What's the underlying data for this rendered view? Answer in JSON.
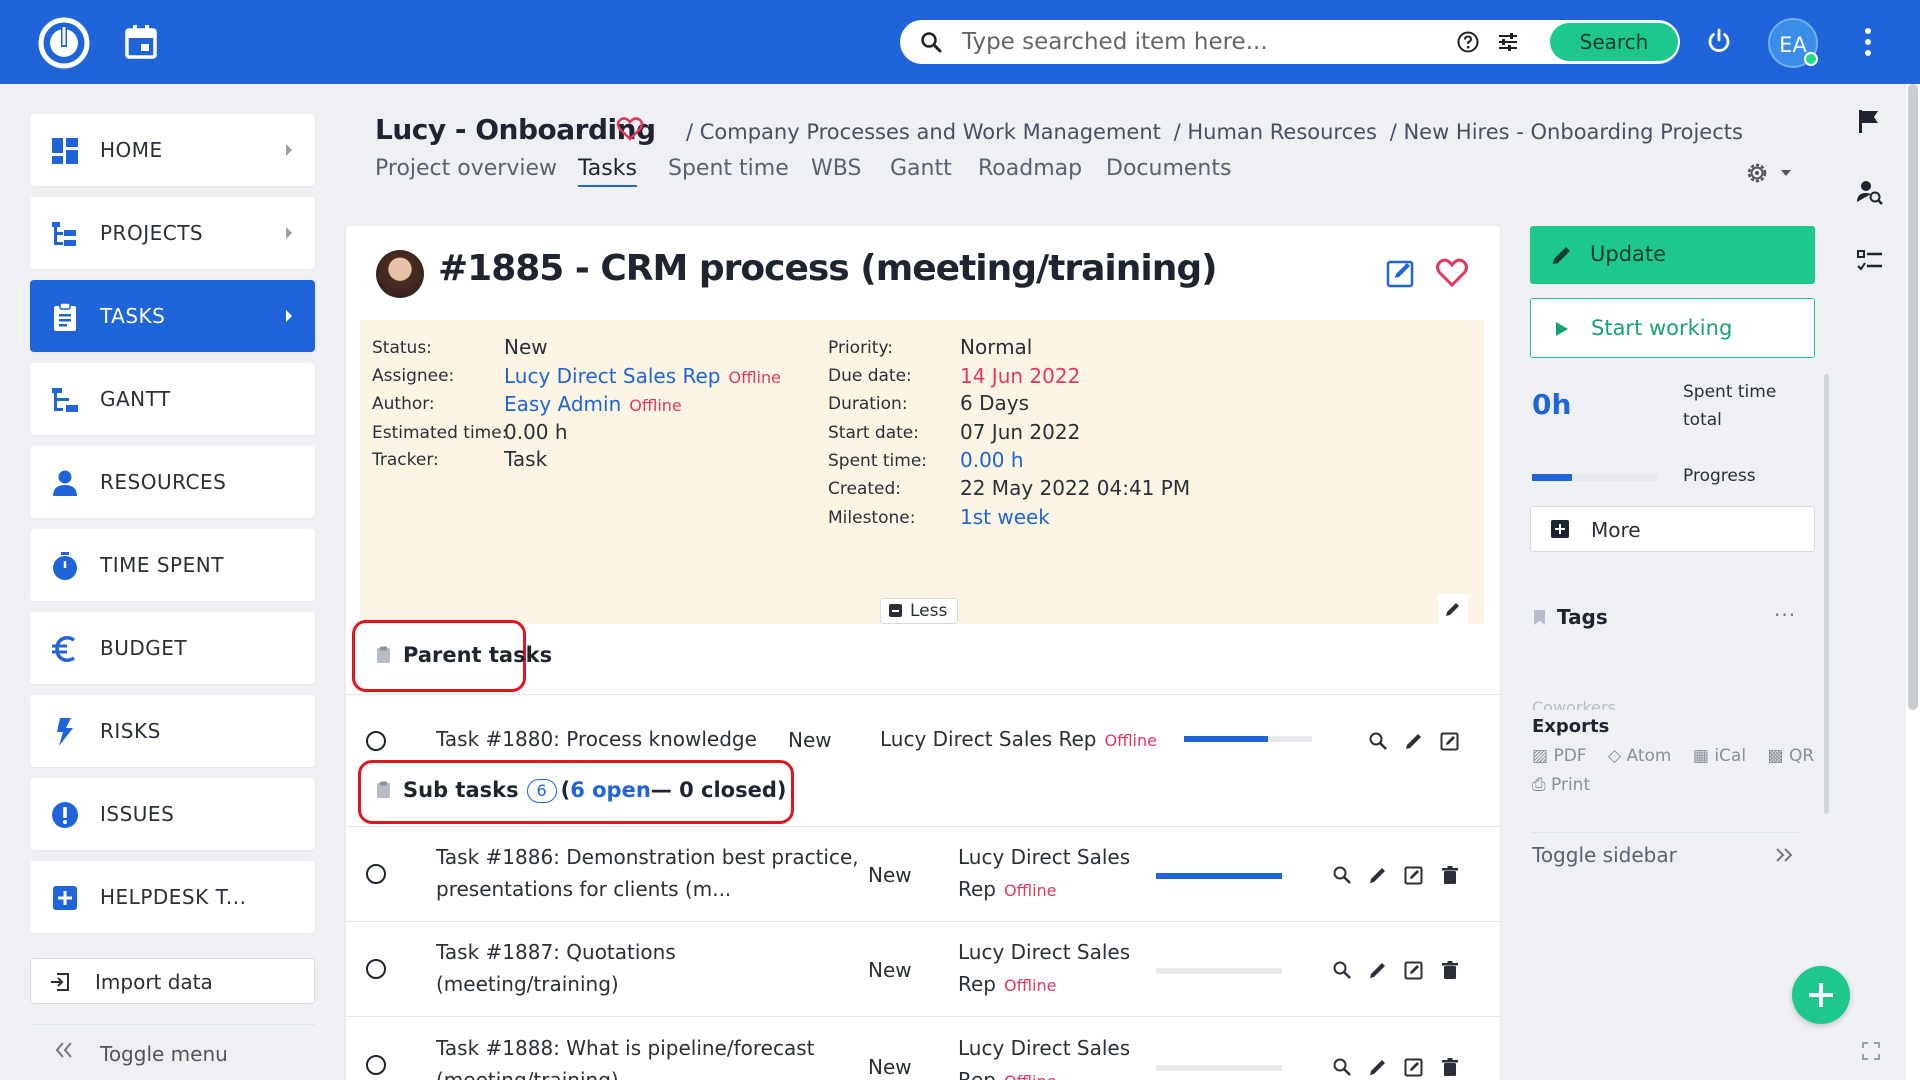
{
  "topbar": {
    "search_placeholder": "Type searched item here...",
    "search_button": "Search",
    "avatar_initials": "EA",
    "colors": {
      "bar": "#1f64d8",
      "accent": "#1ec78c"
    }
  },
  "leftmenu": {
    "items": [
      {
        "label": "HOME",
        "icon": "dashboard-icon",
        "active": false,
        "chevron": true
      },
      {
        "label": "PROJECTS",
        "icon": "projects-tree-icon",
        "active": false,
        "chevron": true
      },
      {
        "label": "TASKS",
        "icon": "clipboard-icon",
        "active": true,
        "chevron": true
      },
      {
        "label": "GANTT",
        "icon": "gantt-icon",
        "active": false,
        "chevron": false
      },
      {
        "label": "RESOURCES",
        "icon": "person-icon",
        "active": false,
        "chevron": false
      },
      {
        "label": "TIME SPENT",
        "icon": "stopwatch-icon",
        "active": false,
        "chevron": false
      },
      {
        "label": "BUDGET",
        "icon": "euro-icon",
        "active": false,
        "chevron": false
      },
      {
        "label": "RISKS",
        "icon": "lightning-icon",
        "active": false,
        "chevron": false
      },
      {
        "label": "ISSUES",
        "icon": "exclamation-icon",
        "active": false,
        "chevron": false
      },
      {
        "label": "HELPDESK T...",
        "icon": "plus-square-icon",
        "active": false,
        "chevron": false
      }
    ],
    "import_label": "Import data",
    "toggle_label": "Toggle menu"
  },
  "header": {
    "project_title": "Lucy - Onboarding",
    "breadcrumb": [
      "/ Company Processes and Work Management",
      "/ Human Resources",
      "/ New Hires - Onboarding Projects"
    ],
    "tabs": [
      "Project overview",
      "Tasks",
      "Spent time",
      "WBS",
      "Gantt",
      "Roadmap",
      "Documents"
    ],
    "active_tab": "Tasks"
  },
  "task": {
    "title": "#1885 - CRM process (meeting/training)",
    "left_attrs": {
      "status_label": "Status:",
      "status": "New",
      "assignee_label": "Assignee:",
      "assignee": "Lucy Direct Sales Rep",
      "assignee_state": "Offline",
      "author_label": "Author:",
      "author": "Easy Admin",
      "author_state": "Offline",
      "estimated_label": "Estimated time:",
      "estimated": "0.00 h",
      "tracker_label": "Tracker:",
      "tracker": "Task"
    },
    "right_attrs": {
      "priority_label": "Priority:",
      "priority": "Normal",
      "due_label": "Due date:",
      "due": "14 Jun 2022",
      "duration_label": "Duration:",
      "duration": "6 Days",
      "start_label": "Start date:",
      "start": "07 Jun 2022",
      "spent_label": "Spent time:",
      "spent": "0.00 h",
      "created_label": "Created:",
      "created": "22 May 2022 04:41 PM",
      "milestone_label": "Milestone:",
      "milestone": "1st week"
    },
    "less_label": "Less"
  },
  "parent_tasks": {
    "heading": "Parent tasks",
    "rows": [
      {
        "name": "Task #1880: Process knowledge",
        "status": "New",
        "assignee": "Lucy Direct Sales Rep",
        "assignee_state": "Offline",
        "progress": 0.66
      }
    ]
  },
  "sub_tasks": {
    "heading": "Sub tasks",
    "count": "6",
    "open_text": "6 open",
    "closed_text": "— 0 closed)",
    "open_paren": "(",
    "rows": [
      {
        "name_line1": "Task #1886: Demonstration best practice,",
        "name_line2": "presentations for clients (m...",
        "status": "New",
        "assignee_line1": "Lucy Direct Sales",
        "assignee_line2": "Rep",
        "assignee_state": "Offline",
        "progress": 1.0
      },
      {
        "name_line1": "Task #1887: Quotations",
        "name_line2": "(meeting/training)",
        "status": "New",
        "assignee_line1": "Lucy Direct Sales",
        "assignee_line2": "Rep",
        "assignee_state": "Offline",
        "progress": 0.0
      },
      {
        "name_line1": "Task #1888: What is pipeline/forecast",
        "name_line2": "(meeting/training)",
        "status": "New",
        "assignee_line1": "Lucy Direct Sales",
        "assignee_line2": "Rep",
        "assignee_state": "Offline",
        "progress": 0.0
      }
    ]
  },
  "sidebar": {
    "update_label": "Update",
    "start_label": "Start working",
    "spent_value": "0h",
    "spent_label_1": "Spent time",
    "spent_label_2": "total",
    "progress_label": "Progress",
    "progress_value": 0.32,
    "more_label": "More",
    "tags_heading": "Tags",
    "tags_dots": "···",
    "coworkers_heading": "Coworkers",
    "exports_heading": "Exports",
    "export_links": [
      "PDF",
      "Atom",
      "iCal",
      "QR"
    ],
    "print_label": "Print",
    "toggle_sidebar_label": "Toggle sidebar"
  }
}
